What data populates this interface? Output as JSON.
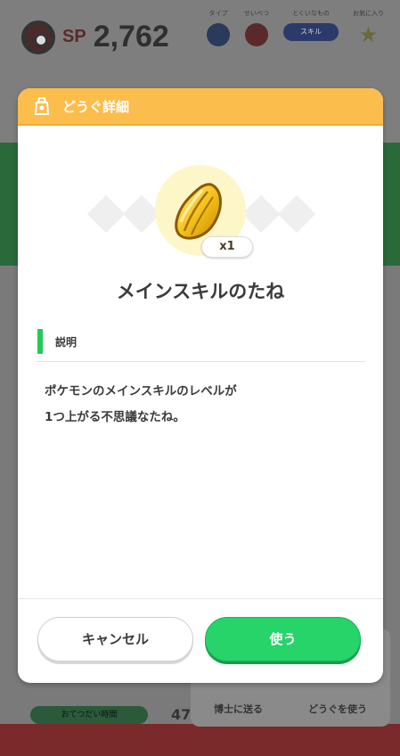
{
  "background": {
    "sp_label": "SP",
    "sp_value": "2,762",
    "filters": [
      {
        "label": "タイプ",
        "icon": "water-drop-icon"
      },
      {
        "label": "せいべつ",
        "icon": "gender-icon"
      },
      {
        "label": "とくいなもの",
        "value": "スキル"
      },
      {
        "label": "お気に入り",
        "icon": "star-icon"
      }
    ],
    "help_label": "おてつだい時間",
    "help_value": "47",
    "actions": [
      "博士に送る",
      "どうぐを使う"
    ]
  },
  "modal": {
    "title": "どうぐ詳細",
    "header_color": "#fbbd4b",
    "item": {
      "icon": "seed-icon",
      "quantity": "x1",
      "name": "メインスキルのたね"
    },
    "section": {
      "label": "説明",
      "accent_color": "#26c85a"
    },
    "description_lines": [
      "ポケモンのメインスキルのレベルが",
      "1つ上がる不思議なたね。"
    ],
    "buttons": {
      "cancel": "キャンセル",
      "use": "使う"
    },
    "use_button_color": "#26d46a"
  }
}
